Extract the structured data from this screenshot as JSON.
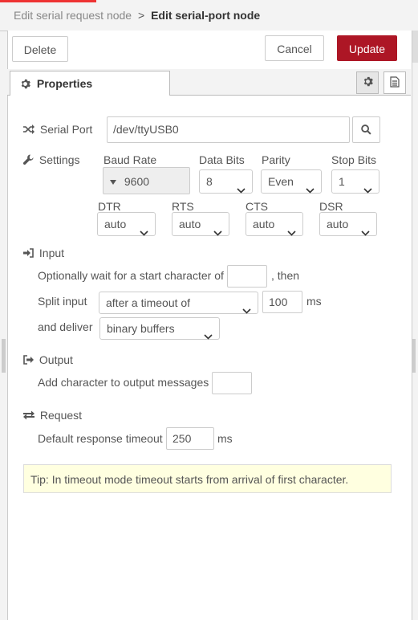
{
  "breadcrumb": {
    "parent": "Edit serial request node",
    "separator": ">",
    "current": "Edit serial-port node"
  },
  "toolbar": {
    "delete_label": "Delete",
    "cancel_label": "Cancel",
    "update_label": "Update"
  },
  "tabs": {
    "properties_label": "Properties"
  },
  "colors": {
    "accent": "#ad1625",
    "tip_bg": "#ffffe0"
  },
  "serial_port": {
    "label": "Serial Port",
    "value": "/dev/ttyUSB0"
  },
  "settings": {
    "label": "Settings",
    "baud_rate": {
      "label": "Baud Rate",
      "value": "9600"
    },
    "data_bits": {
      "label": "Data Bits",
      "value": "8"
    },
    "parity": {
      "label": "Parity",
      "value": "Even"
    },
    "stop_bits": {
      "label": "Stop Bits",
      "value": "1"
    },
    "dtr": {
      "label": "DTR",
      "value": "auto"
    },
    "rts": {
      "label": "RTS",
      "value": "auto"
    },
    "cts": {
      "label": "CTS",
      "value": "auto"
    },
    "dsr": {
      "label": "DSR",
      "value": "auto"
    }
  },
  "input": {
    "label": "Input",
    "start_char_prefix": "Optionally wait for a start character of",
    "start_char_value": "",
    "start_char_suffix": ", then",
    "split_label": "Split input",
    "split_mode": "after a timeout of",
    "split_value": "100",
    "split_unit": "ms",
    "deliver_label": "and deliver",
    "deliver_value": "binary buffers"
  },
  "output": {
    "label": "Output",
    "add_char_label": "Add character to output messages",
    "add_char_value": ""
  },
  "request": {
    "label": "Request",
    "timeout_label": "Default response timeout",
    "timeout_value": "250",
    "timeout_unit": "ms"
  },
  "tip": "Tip: In timeout mode timeout starts from arrival of first character."
}
